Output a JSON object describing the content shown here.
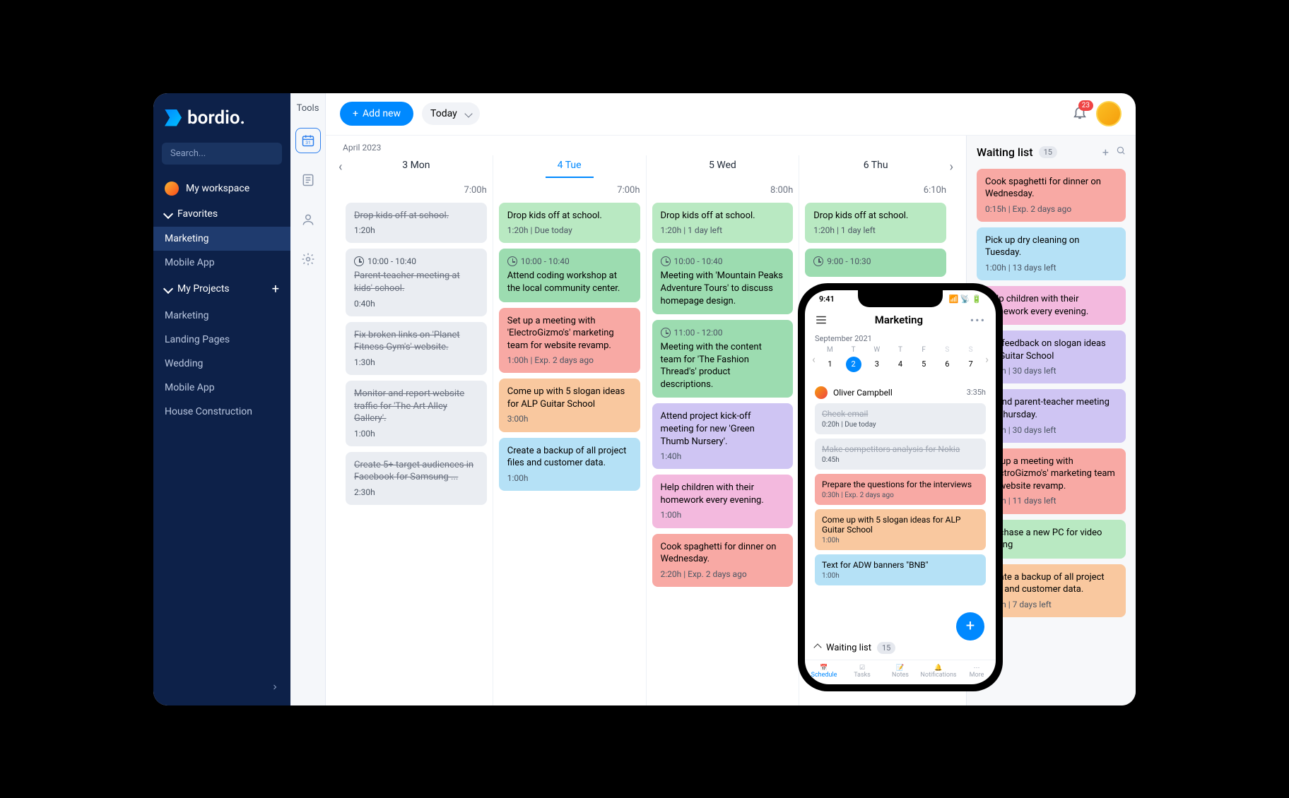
{
  "brand": "bordio.",
  "search_placeholder": "Search...",
  "workspace": "My workspace",
  "favorites_label": "Favorites",
  "fav_items": [
    "Marketing",
    "Mobile App"
  ],
  "projects_label": "My Projects",
  "projects": [
    "Marketing",
    "Landing Pages",
    "Wedding",
    "Mobile App",
    "House Construction"
  ],
  "tools_label": "Tools",
  "add_new": "Add new",
  "today": "Today",
  "notif_count": "23",
  "month": "April 2023",
  "days": [
    "3 Mon",
    "4 Tue",
    "5 Wed",
    "6 Thu"
  ],
  "hours": [
    "7:00h",
    "7:00h",
    "8:00h",
    "6:10h"
  ],
  "columns": [
    [
      {
        "title": "Drop kids off at school.",
        "meta": "1:20h",
        "cls": "c-gray done"
      },
      {
        "time": "10:00 - 10:40",
        "title": "Parent-teacher meeting at kids' school.",
        "meta": "0:40h",
        "cls": "c-gray done"
      },
      {
        "title": "Fix broken links on 'Planet Fitness Gym's' website.",
        "meta": "1:30h",
        "cls": "c-gray done"
      },
      {
        "title": "Monitor and report website traffic for 'The Art Alley Gallery'.",
        "meta": "1:00h",
        "cls": "c-gray done"
      },
      {
        "title": "Create 5+ target audiences in Facebook for Samsung ...",
        "meta": "2:30h",
        "cls": "c-gray done"
      }
    ],
    [
      {
        "title": "Drop kids off at school.",
        "meta": "1:20h | Due today",
        "cls": "c-green"
      },
      {
        "time": "10:00 - 10:40",
        "title": "Attend coding workshop at the local community center.",
        "cls": "c-green2"
      },
      {
        "title": "Set up a meeting with 'ElectroGizmo's' marketing team for website revamp.",
        "meta": "1:00h | Exp. 2 days ago",
        "cls": "c-red"
      },
      {
        "title": "Come up with 5 slogan ideas for ALP Guitar School",
        "meta": "3:00h",
        "cls": "c-orange"
      },
      {
        "title": "Create a backup of all project files and customer data.",
        "meta": "1:00h",
        "cls": "c-blue"
      }
    ],
    [
      {
        "title": "Drop kids off at school.",
        "meta": "1:20h | 1 day left",
        "cls": "c-green"
      },
      {
        "time": "10:00 - 10:40",
        "title": "Meeting with 'Mountain Peaks Adventure Tours' to discuss homepage design.",
        "cls": "c-green2"
      },
      {
        "time": "11:00 - 12:00",
        "title": "Meeting with the content team for 'The Fashion Thread's' product descriptions.",
        "cls": "c-green2"
      },
      {
        "title": "Attend project kick-off meeting for new 'Green Thumb Nursery'.",
        "meta": "1:40h",
        "cls": "c-purple"
      },
      {
        "title": "Help children with their homework every evening.",
        "meta": "1:00h",
        "cls": "c-pink"
      },
      {
        "title": "Cook spaghetti for dinner on Wednesday.",
        "meta": "2:20h | Exp. 2 days ago",
        "cls": "c-red"
      }
    ],
    [
      {
        "title": "Drop kids off at school.",
        "meta": "1:20h | 1 day left",
        "cls": "c-green"
      },
      {
        "time": "9:00 - 10:30",
        "title": "",
        "cls": "c-green2"
      }
    ]
  ],
  "waiting_title": "Waiting list",
  "waiting_count": "15",
  "waiting": [
    {
      "title": "Cook spaghetti for dinner on Wednesday.",
      "meta": "0:15h | Exp. 2 days ago",
      "cls": "c-red"
    },
    {
      "title": "Pick up dry cleaning on Tuesday.",
      "meta": "1:00h | 13 days left",
      "cls": "c-blue"
    },
    {
      "title": "Help children with their homework every evening.",
      "meta": "",
      "cls": "c-pink"
    },
    {
      "title": "Get feedback on slogan ideas for Guitar School",
      "meta": "1:00h | 30 days left",
      "cls": "c-purple"
    },
    {
      "title": "Attend parent-teacher meeting on Thursday.",
      "meta": "1:00h | 30 days left",
      "cls": "c-purple"
    },
    {
      "title": "Set up a meeting with 'ElectroGizmo's' marketing team for website revamp.",
      "meta": "1:00h | 11 days left",
      "cls": "c-red"
    },
    {
      "title": "Purchase a new PC for video editing",
      "meta": "",
      "cls": "c-green"
    },
    {
      "title": "Create a backup of all project files and customer data.",
      "meta": "1:00h | 7 days left",
      "cls": "c-orange"
    }
  ],
  "phone": {
    "time": "9:41",
    "title": "Marketing",
    "month": "September 2021",
    "dows": [
      "M",
      "T",
      "W",
      "T",
      "F",
      "S",
      "S"
    ],
    "nums": [
      "1",
      "2",
      "3",
      "4",
      "5",
      "6",
      "7"
    ],
    "user": "Oliver Campbell",
    "hours": "3:35h",
    "tasks": [
      {
        "title": "Check email",
        "meta": "0:20h | Due today",
        "cls": "c-gray done"
      },
      {
        "title": "Make competitors analysis for Nokia",
        "meta": "0:45h",
        "cls": "c-gray done"
      },
      {
        "title": "Prepare the questions for the interviews",
        "meta": "0:30h | Exp. 2 days ago",
        "cls": "c-red"
      },
      {
        "title": "Come up with 5 slogan ideas for ALP Guitar School",
        "meta": "1:00h",
        "cls": "c-orange"
      },
      {
        "title": "Text for ADW banners \"BNB\"",
        "meta": "1:00h",
        "cls": "c-blue"
      }
    ],
    "wl_label": "Waiting list",
    "wl_count": "15",
    "nav": [
      "Schedule",
      "Tasks",
      "Notes",
      "Notifications",
      "More"
    ]
  }
}
